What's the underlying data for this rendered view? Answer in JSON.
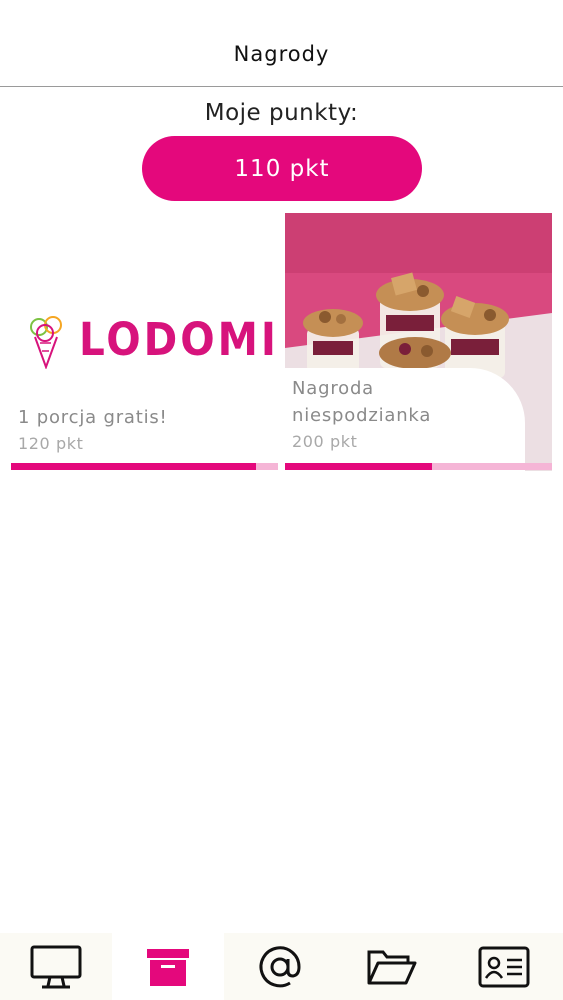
{
  "header": {
    "title": "Nagrody"
  },
  "points": {
    "label": "Moje punkty:",
    "value": "110 pkt"
  },
  "rewards": [
    {
      "brand": "LODOMINO",
      "name": "1 porcja gratis!",
      "cost": "120 pkt",
      "progress": 0.917
    },
    {
      "name_line1": "Nagroda",
      "name_line2": "niespodzianka",
      "cost": "200 pkt",
      "progress": 0.55
    }
  ],
  "tabbar": {
    "items": [
      {
        "icon": "monitor-icon",
        "active": false
      },
      {
        "icon": "archive-box-icon",
        "active": true
      },
      {
        "icon": "at-sign-icon",
        "active": false
      },
      {
        "icon": "folder-open-icon",
        "active": false
      },
      {
        "icon": "id-card-icon",
        "active": false
      }
    ]
  },
  "colors": {
    "accent": "#e4087c",
    "accent_light": "#f5b5d6",
    "tabbar_bg": "#fbfaf4"
  }
}
